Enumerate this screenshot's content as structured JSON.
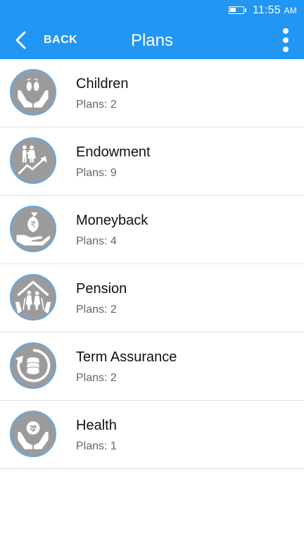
{
  "status_bar": {
    "time": "11:55",
    "ampm": "AM"
  },
  "app_bar": {
    "back_label": "BACK",
    "title": "Plans"
  },
  "plans": [
    {
      "name": "Children",
      "count": "Plans: 2",
      "icon": "baby-feet-hands-icon"
    },
    {
      "name": "Endowment",
      "count": "Plans: 9",
      "icon": "family-growth-icon"
    },
    {
      "name": "Moneyback",
      "count": "Plans: 4",
      "icon": "money-bag-hand-icon"
    },
    {
      "name": "Pension",
      "count": "Plans: 2",
      "icon": "elderly-house-icon"
    },
    {
      "name": "Term Assurance",
      "count": "Plans: 2",
      "icon": "coins-cycle-icon"
    },
    {
      "name": "Health",
      "count": "Plans: 1",
      "icon": "heart-hands-icon"
    }
  ],
  "colors": {
    "primary": "#2196f3",
    "icon_bg": "#9b9b9b",
    "icon_ring": "#66a8e0"
  }
}
